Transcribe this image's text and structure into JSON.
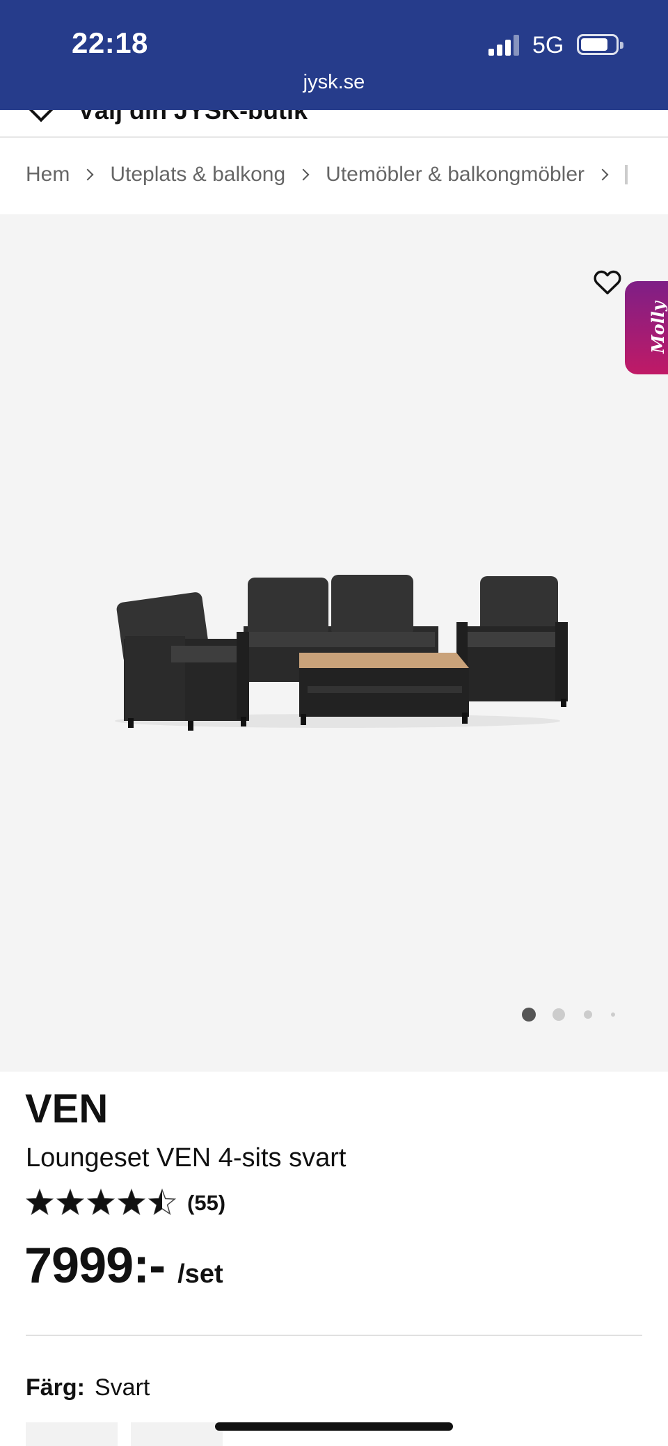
{
  "status_bar": {
    "time": "22:18",
    "network": "5G",
    "url": "jysk.se",
    "background": "#263c8b"
  },
  "store_selector": {
    "label": "Välj din JYSK-butik",
    "icon": "location-pin-icon"
  },
  "breadcrumb": {
    "items": [
      "Hem",
      "Uteplats & balkong",
      "Utemöbler & balkongmöbler"
    ]
  },
  "gallery": {
    "favorite_icon": "heart-outline-icon",
    "chat_widget_label": "Molly",
    "chat_widget_color": "#b01a6e",
    "image": "outdoor-lounge-set-image",
    "slide_count": 4,
    "active_slide": 1
  },
  "product": {
    "brand": "VEN",
    "name": "Loungeset VEN 4-sits svart",
    "rating": 4.5,
    "rating_max": 5,
    "review_count": "(55)",
    "price": "7999:-",
    "price_unit": "/set",
    "color_label": "Färg:",
    "color_value": "Svart"
  }
}
